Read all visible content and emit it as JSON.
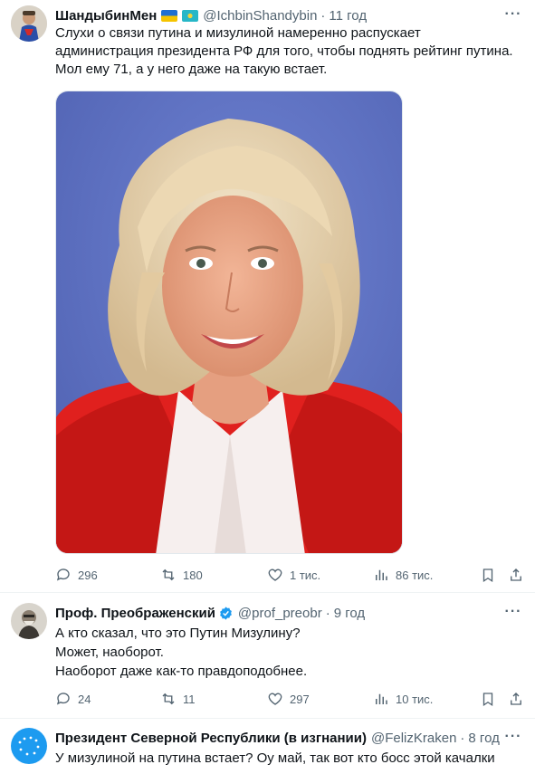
{
  "tweets": [
    {
      "name": "ШандыбинМен",
      "handle": "@IchbinShandybin",
      "time": "11 год",
      "text": "Слухи о связи путина и мизулиной намеренно распускает администрация президента РФ для того, чтобы поднять рейтинг путина. Мол ему 71, а у него даже на такую встает.",
      "stats": {
        "replies": "296",
        "retweets": "180",
        "likes": "1 тис.",
        "views": "86 тис."
      }
    },
    {
      "name": "Проф. Преображенский",
      "handle": "@prof_preobr",
      "time": "9 год",
      "text": "А кто сказал, что это Путин Мизулину?\nМожет, наоборот.\nНаоборот даже как-то правдоподобнее.",
      "stats": {
        "replies": "24",
        "retweets": "11",
        "likes": "297",
        "views": "10 тис."
      }
    },
    {
      "name": "Президент Северной Республики (в изгнании)",
      "handle": "@FelizKraken",
      "time": "8 год",
      "text": "У мизулиной на путина встает? Оу май, так вот кто босс этой качалки"
    }
  ],
  "dot": "·",
  "more_glyph": "···",
  "colors": {
    "secondary": "#536471",
    "verified": "#1d9bf0",
    "divider": "#eff3f4",
    "photo_bg": "#5e71c2"
  }
}
